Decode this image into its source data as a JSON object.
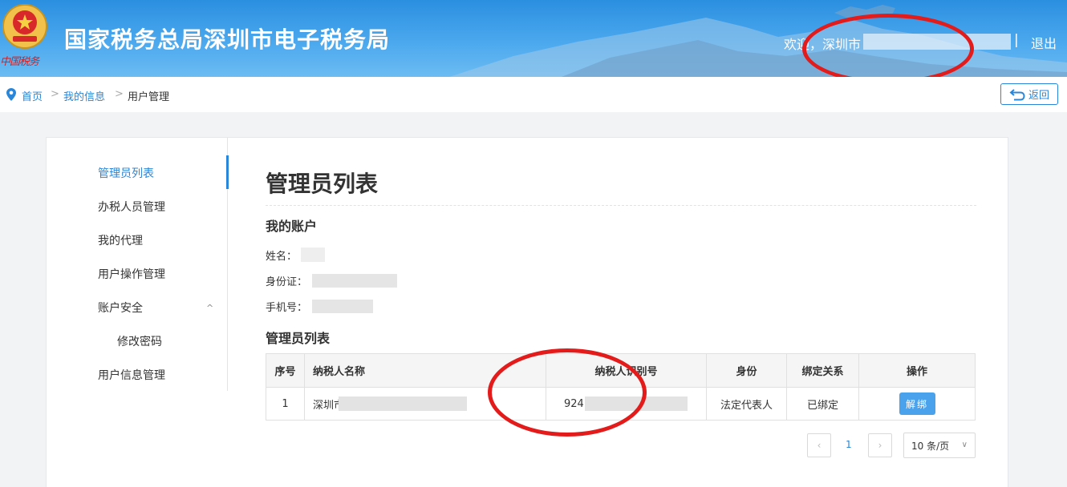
{
  "header": {
    "emblem_text": "中国税务",
    "site_title": "国家税务总局深圳市电子税务局",
    "welcome": "欢迎，深圳市",
    "separator": "|",
    "logout": "退出"
  },
  "breadcrumb": {
    "items": [
      "首页",
      "我的信息",
      "用户管理"
    ],
    "separator": ">",
    "back": "返回"
  },
  "sidebar": {
    "items": [
      "管理员列表",
      "办税人员管理",
      "我的代理",
      "用户操作管理",
      "账户安全",
      "修改密码",
      "用户信息管理"
    ],
    "caret": "^"
  },
  "main": {
    "title": "管理员列表",
    "my_account": "我的账户",
    "name_label": "姓名：",
    "id_label": "身份证：",
    "phone_label": "手机号：",
    "list_title": "管理员列表",
    "table": {
      "headers": [
        "序号",
        "纳税人名称",
        "纳税人识别号",
        "身份",
        "绑定关系",
        "操作"
      ],
      "rows": [
        {
          "index": "1",
          "name": "深圳市",
          "tax_id": "924",
          "role": "法定代表人",
          "binding": "已绑定",
          "action": "解绑"
        }
      ]
    }
  },
  "pagination": {
    "prev": "‹",
    "page": "1",
    "next": "›",
    "page_size": "10 条/页"
  },
  "colors": {
    "accent": "#2a86d8",
    "annotation": "#e41b1b"
  }
}
